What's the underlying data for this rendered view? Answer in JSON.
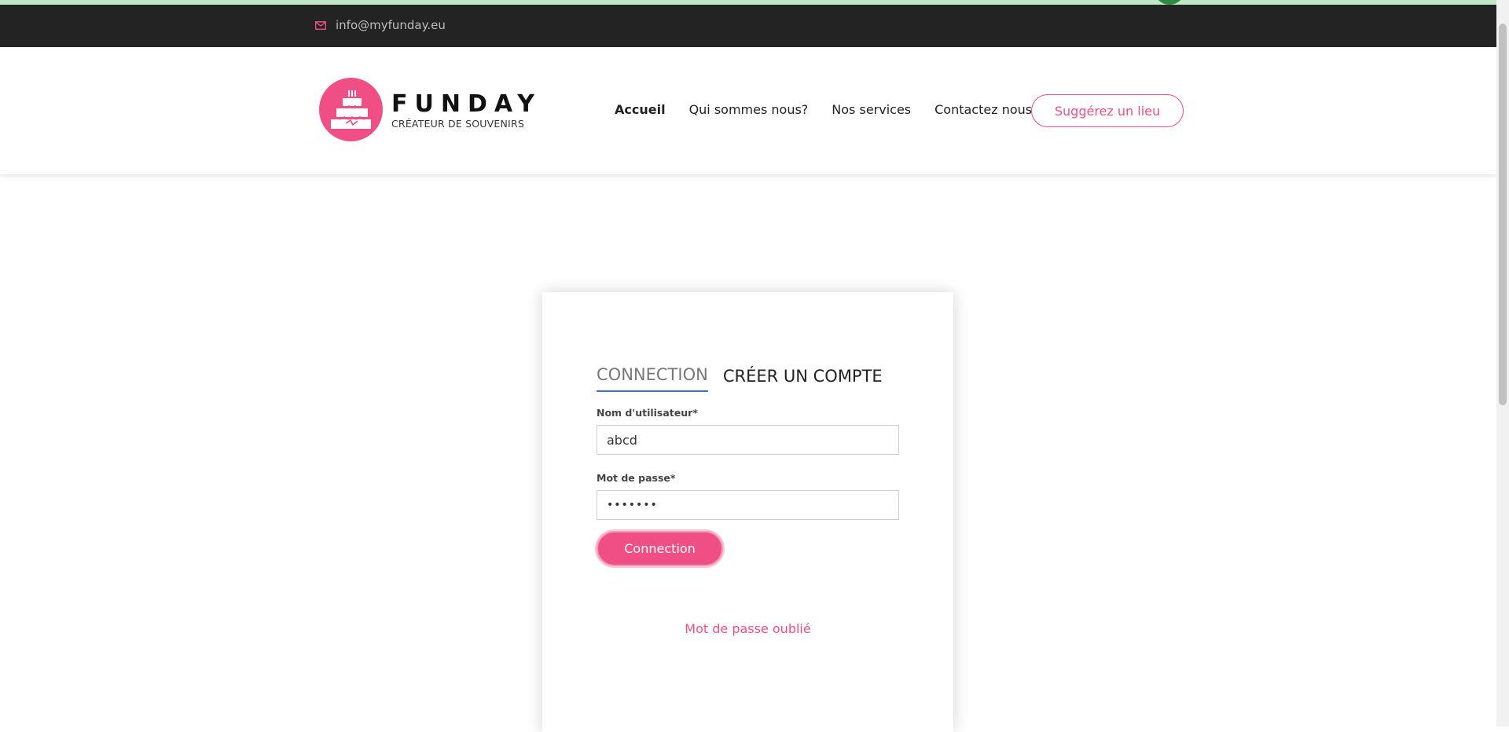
{
  "topbar": {
    "email": "info@myfunday.eu"
  },
  "logo": {
    "brand": "FUNDAY",
    "tagline": "CRÉATEUR DE SOUVENIRS"
  },
  "nav": {
    "items": [
      {
        "label": "Accueil",
        "active": true
      },
      {
        "label": "Qui sommes nous?"
      },
      {
        "label": "Nos services"
      },
      {
        "label": "Contactez nous"
      }
    ],
    "cta_label": "Suggérez un lieu"
  },
  "login": {
    "tabs": [
      {
        "label": "CONNECTION",
        "active": true
      },
      {
        "label": "CRÉER UN COMPTE"
      }
    ],
    "username_label": "Nom d'utilisateur*",
    "username_value": "abcd",
    "password_label": "Mot de passe*",
    "password_value": "•••••••",
    "submit_label": "Connection",
    "forgot_label": "Mot de passe oublié"
  },
  "colors": {
    "accent": "#ef4f84",
    "topbar": "#232323",
    "tab_underline": "#3a6fd8"
  }
}
